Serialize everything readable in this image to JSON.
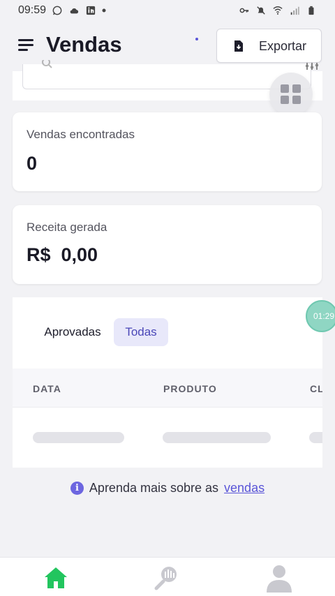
{
  "statusbar": {
    "time": "09:59"
  },
  "header": {
    "title": "Vendas",
    "export_label": "Exportar"
  },
  "cards": {
    "sales_found": {
      "label": "Vendas encontradas",
      "value": "0"
    },
    "revenue": {
      "label": "Receita gerada",
      "value": "R$  0,00"
    }
  },
  "tabs": [
    {
      "label": "Aprovadas",
      "selected": false
    },
    {
      "label": "Todas",
      "selected": true
    }
  ],
  "table": {
    "columns": [
      "DATA",
      "PRODUTO",
      "CL"
    ]
  },
  "timer": "01:29",
  "learn_more": {
    "text": "Aprenda mais sobre as",
    "link": "vendas"
  },
  "colors": {
    "accent": "#5a55d8",
    "home_active": "#22c55e",
    "tab_selected_bg": "#e8e8fa"
  },
  "icons": {
    "statusbar_left": [
      "whatsapp-icon",
      "cloud-icon",
      "linkedin-icon",
      "dot-icon"
    ],
    "statusbar_right": [
      "key-icon",
      "mute-icon",
      "wifi-icon",
      "signal-icon",
      "battery-icon"
    ],
    "nav": [
      "home-icon",
      "analytics-icon",
      "profile-icon"
    ]
  }
}
